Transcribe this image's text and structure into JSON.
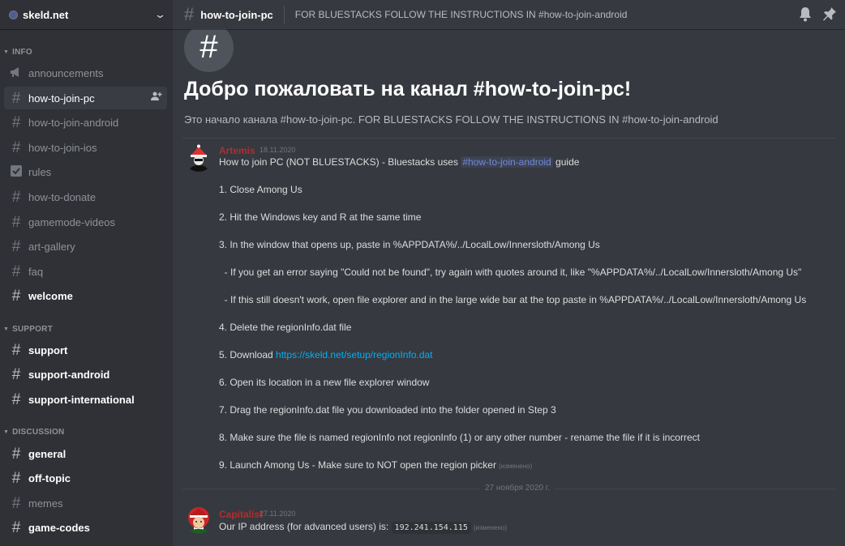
{
  "guild": {
    "name": "skeld.net"
  },
  "categories": [
    {
      "label": "INFO"
    },
    {
      "label": "SUPPORT"
    },
    {
      "label": "DISCUSSION"
    }
  ],
  "channels": [
    {
      "name": "announcements",
      "icon": "megaphone-icon"
    },
    {
      "name": "how-to-join-pc",
      "icon": "hash-icon",
      "selected": true
    },
    {
      "name": "how-to-join-android",
      "icon": "hash-icon"
    },
    {
      "name": "how-to-join-ios",
      "icon": "hash-icon"
    },
    {
      "name": "rules",
      "icon": "rules-icon"
    },
    {
      "name": "how-to-donate",
      "icon": "hash-icon"
    },
    {
      "name": "gamemode-videos",
      "icon": "hash-icon"
    },
    {
      "name": "art-gallery",
      "icon": "hash-icon"
    },
    {
      "name": "faq",
      "icon": "hash-icon"
    },
    {
      "name": "welcome",
      "icon": "hash-icon",
      "unread": true
    },
    {
      "name": "support",
      "icon": "hash-icon",
      "unread": true
    },
    {
      "name": "support-android",
      "icon": "hash-icon",
      "unread": true
    },
    {
      "name": "support-international",
      "icon": "hash-icon",
      "unread": true
    },
    {
      "name": "general",
      "icon": "hash-icon",
      "unread": true
    },
    {
      "name": "off-topic",
      "icon": "hash-icon",
      "unread": true
    },
    {
      "name": "memes",
      "icon": "hash-icon"
    },
    {
      "name": "game-codes",
      "icon": "hash-icon",
      "unread": true
    }
  ],
  "topbar": {
    "channel_name": "how-to-join-pc",
    "topic": "FOR BLUESTACKS FOLLOW THE INSTRUCTIONS IN #how-to-join-android"
  },
  "welcome": {
    "icon": "#",
    "title": "Добро пожаловать на канал #how-to-join-pc!",
    "subtitle": "Это начало канала #how-to-join-pc. FOR BLUESTACKS FOLLOW THE INSTRUCTIONS IN #how-to-join-android"
  },
  "messages": [
    {
      "author": "Artemis",
      "timestamp": "18.11.2020",
      "intro_before": "How to join PC (NOT BLUESTACKS) - Bluestacks uses ",
      "intro_mention": "#how-to-join-android",
      "intro_after": " guide",
      "steps": [
        "1. Close Among Us",
        "2. Hit the Windows key and R at the same time",
        "3. In the window that opens up, paste in %APPDATA%/../LocalLow/Innersloth/Among Us",
        "  - If you get an error saying \"Could not be found\", try again with quotes around it, like \"%APPDATA%/../LocalLow/Innersloth/Among Us\"",
        "  - If this still doesn't work, open file explorer and in the large wide bar at the top paste in %APPDATA%/../LocalLow/Innersloth/Among Us",
        "4. Delete the regionInfo.dat file"
      ],
      "step5_prefix": "5. Download ",
      "step5_link": "https://skeld.net/setup/regionInfo.dat",
      "steps_after": [
        "6. Open its location in a new file explorer window",
        "7. Drag the regionInfo.dat file you downloaded into the folder opened in Step 3",
        "8. Make sure the file is named regionInfo not regionInfo (1) or any other number - rename the file if it is incorrect"
      ],
      "step9": "9. Launch Among Us - Make sure to NOT open the region picker",
      "edited": "(изменено)"
    },
    {
      "author": "Capitalist",
      "timestamp": "27.11.2020",
      "text_prefix": "Our IP address (for advanced users) is: ",
      "ip": "192.241.154.115",
      "edited": "(изменено)"
    }
  ],
  "date_separator": "27 ноября 2020 г."
}
